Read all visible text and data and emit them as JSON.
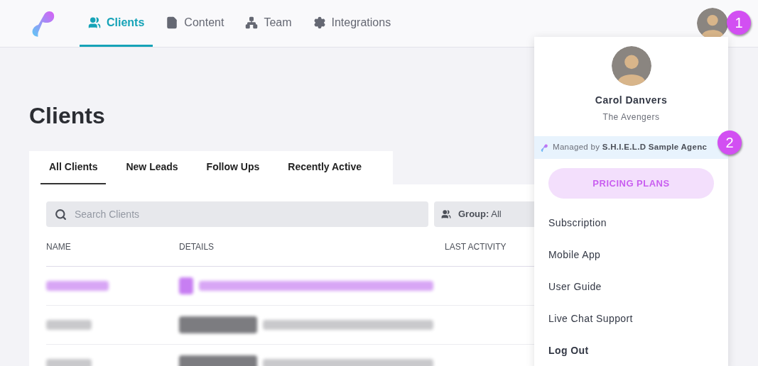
{
  "nav": {
    "items": [
      {
        "label": "Clients",
        "selected": true
      },
      {
        "label": "Content",
        "selected": false
      },
      {
        "label": "Team",
        "selected": false
      },
      {
        "label": "Integrations",
        "selected": false
      }
    ]
  },
  "page": {
    "title": "Clients"
  },
  "tabs": [
    {
      "label": "All Clients",
      "selected": true
    },
    {
      "label": "New Leads",
      "selected": false
    },
    {
      "label": "Follow Ups",
      "selected": false
    },
    {
      "label": "Recently Active",
      "selected": false
    }
  ],
  "search": {
    "placeholder": "Search Clients"
  },
  "group_filter": {
    "label": "Group:",
    "value": "All"
  },
  "table": {
    "columns": [
      "NAME",
      "DETAILS",
      "LAST ACTIVITY"
    ],
    "rows": [
      {
        "kind": "lead"
      },
      {
        "kind": "client"
      },
      {
        "kind": "client"
      }
    ]
  },
  "user_menu": {
    "name": "Carol Danvers",
    "organization": "The Avengers",
    "managed_prefix": "Managed by",
    "managed_agency": "S.H.I.E.L.D Sample Agenc",
    "pricing_button": "PRICING PLANS",
    "items": [
      {
        "label": "Subscription",
        "kind": "normal"
      },
      {
        "label": "Mobile App",
        "kind": "normal"
      },
      {
        "label": "User Guide",
        "kind": "normal"
      },
      {
        "label": "Live Chat Support",
        "kind": "normal"
      },
      {
        "label": "Log Out",
        "kind": "strong"
      }
    ]
  },
  "callouts": [
    "1",
    "2"
  ]
}
